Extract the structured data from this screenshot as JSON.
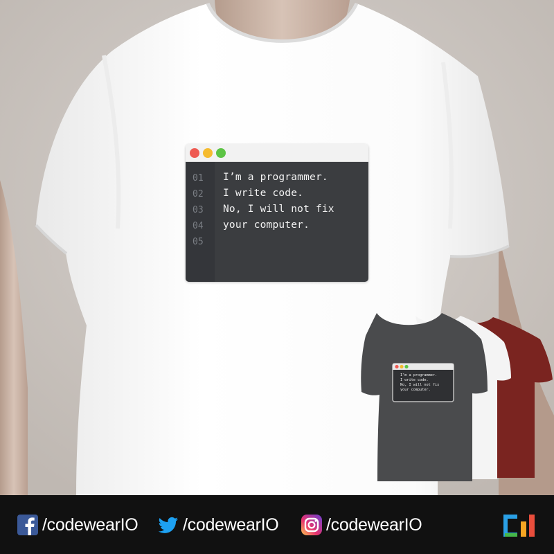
{
  "shirt_print": {
    "line_numbers": [
      "01",
      "02",
      "03",
      "04",
      "05"
    ],
    "code_lines": [
      "I’m a programmer.",
      "I write code.",
      "No, I will not fix",
      "your computer."
    ],
    "window_dot_colors": [
      "#ee5a52",
      "#f5bb2f",
      "#5dc445"
    ]
  },
  "variants": {
    "colors": [
      "#4a4b4d",
      "#f4f4f4",
      "#7a2420"
    ],
    "mini_code_lines": [
      "I’m a programmer.",
      "I write code.",
      "No, I will not fix",
      "your computer."
    ]
  },
  "footer": {
    "facebook_handle": "/codewearIO",
    "twitter_handle": "/codewearIO",
    "instagram_handle": "/codewearIO",
    "logo_colors": [
      "#2aa0e6",
      "#45b649",
      "#f5a623",
      "#e94e3c"
    ],
    "icon_colors": {
      "facebook": "#3b5998",
      "twitter": "#1da1f2"
    }
  }
}
